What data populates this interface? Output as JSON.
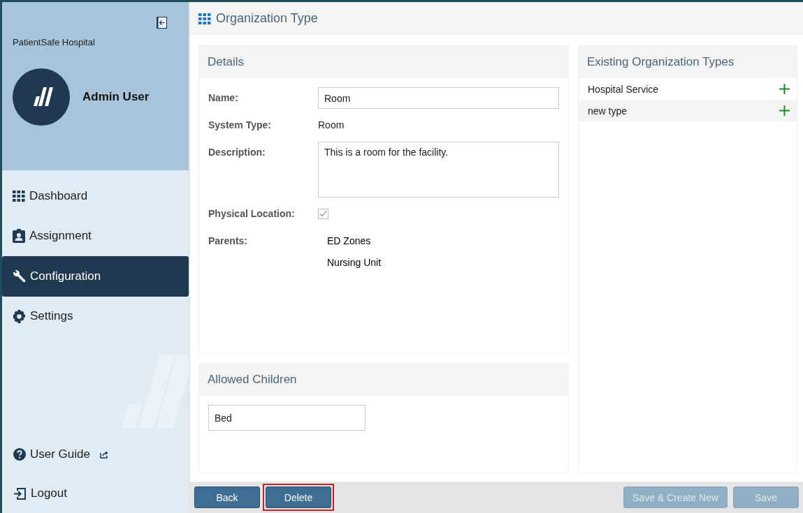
{
  "sidebar": {
    "organization": "PatientSafe Hospital",
    "user": {
      "name": "Admin User"
    },
    "nav": [
      {
        "label": "Dashboard",
        "selected": false
      },
      {
        "label": "Assignment",
        "selected": false
      },
      {
        "label": "Configuration",
        "selected": true
      },
      {
        "label": "Settings",
        "selected": false
      }
    ],
    "bottom_links": [
      {
        "label": "User Guide",
        "external": true
      },
      {
        "label": "Logout",
        "external": false
      }
    ]
  },
  "page": {
    "title": "Organization Type"
  },
  "details": {
    "title": "Details",
    "fields": [
      {
        "kind": "input",
        "label": "Name:",
        "value": "Room"
      },
      {
        "kind": "text",
        "label": "System Type:",
        "value": "Room"
      },
      {
        "kind": "textarea",
        "label": "Description:",
        "value": "This is a room for the facility."
      },
      {
        "kind": "checkbox",
        "label": "Physical Location:",
        "checked": true,
        "disabled": true
      },
      {
        "kind": "list",
        "label": "Parents:",
        "items": [
          "ED Zones",
          "Nursing Unit"
        ]
      }
    ]
  },
  "allowed_children": {
    "title": "Allowed Children",
    "value": "Bed"
  },
  "existing_types": {
    "title": "Existing Organization Types",
    "items": [
      {
        "label": "Hospital Service"
      },
      {
        "label": "new type"
      }
    ]
  },
  "footer": {
    "left_buttons": [
      {
        "label": "Back",
        "disabled": false,
        "highlighted": false
      },
      {
        "label": "Delete",
        "disabled": false,
        "highlighted": true
      }
    ],
    "right_buttons": [
      {
        "label": "Save & Create New",
        "disabled": true,
        "highlighted": false
      },
      {
        "label": "Save",
        "disabled": true,
        "highlighted": false
      }
    ]
  }
}
